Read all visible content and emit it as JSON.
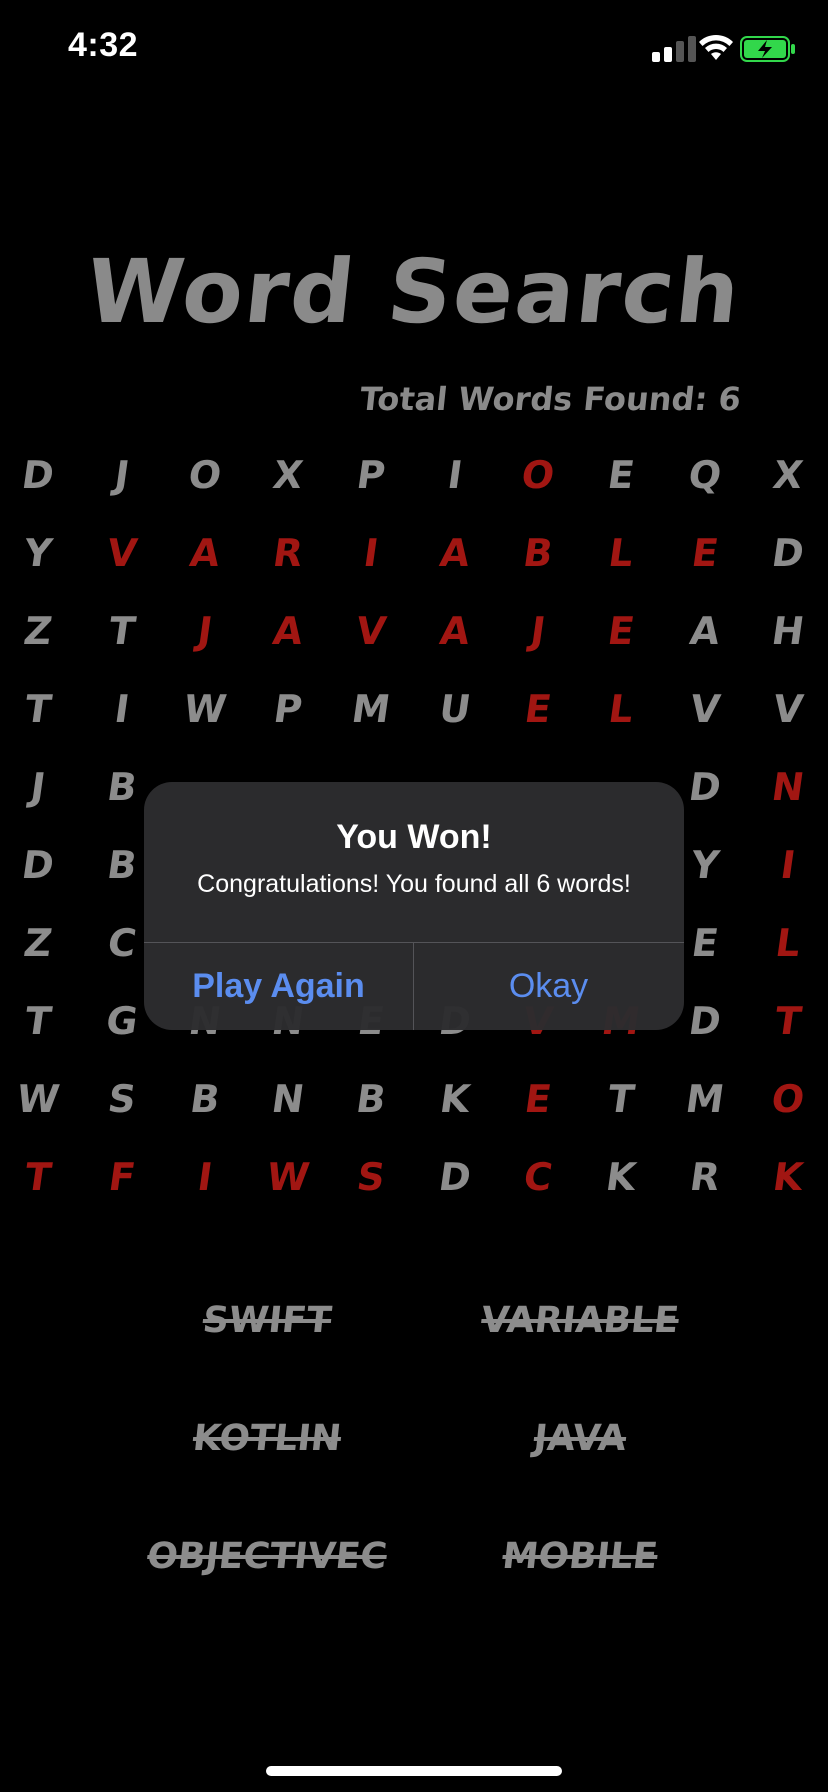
{
  "status_bar": {
    "time": "4:32",
    "icons": [
      "cellular-signal-icon",
      "wifi-icon",
      "battery-charging-icon"
    ],
    "battery_color": "#32d74b"
  },
  "title": "Word Search",
  "total_found": "Total Words Found: 6",
  "colors": {
    "letter": "#8c8c8c",
    "found_letter": "#a11612",
    "background": "#000000",
    "alert_button": "#5b8def"
  },
  "grid": [
    [
      {
        "l": "D",
        "f": false
      },
      {
        "l": "J",
        "f": false
      },
      {
        "l": "O",
        "f": false
      },
      {
        "l": "X",
        "f": false
      },
      {
        "l": "P",
        "f": false
      },
      {
        "l": "I",
        "f": false
      },
      {
        "l": "O",
        "f": true
      },
      {
        "l": "E",
        "f": false
      },
      {
        "l": "Q",
        "f": false
      },
      {
        "l": "X",
        "f": false
      }
    ],
    [
      {
        "l": "Y",
        "f": false
      },
      {
        "l": "V",
        "f": true
      },
      {
        "l": "A",
        "f": true
      },
      {
        "l": "R",
        "f": true
      },
      {
        "l": "I",
        "f": true
      },
      {
        "l": "A",
        "f": true
      },
      {
        "l": "B",
        "f": true
      },
      {
        "l": "L",
        "f": true
      },
      {
        "l": "E",
        "f": true
      },
      {
        "l": "D",
        "f": false
      }
    ],
    [
      {
        "l": "Z",
        "f": false
      },
      {
        "l": "T",
        "f": false
      },
      {
        "l": "J",
        "f": true
      },
      {
        "l": "A",
        "f": true
      },
      {
        "l": "V",
        "f": true
      },
      {
        "l": "A",
        "f": true
      },
      {
        "l": "J",
        "f": true
      },
      {
        "l": "E",
        "f": true
      },
      {
        "l": "A",
        "f": false
      },
      {
        "l": "H",
        "f": false
      }
    ],
    [
      {
        "l": "T",
        "f": false
      },
      {
        "l": "I",
        "f": false
      },
      {
        "l": "W",
        "f": false
      },
      {
        "l": "P",
        "f": false
      },
      {
        "l": "M",
        "f": false
      },
      {
        "l": "U",
        "f": false
      },
      {
        "l": "E",
        "f": true
      },
      {
        "l": "L",
        "f": true
      },
      {
        "l": "V",
        "f": false
      },
      {
        "l": "V",
        "f": false
      }
    ],
    [
      {
        "l": "J",
        "f": false
      },
      {
        "l": "B",
        "f": false
      },
      {
        "l": "",
        "f": false
      },
      {
        "l": "",
        "f": false
      },
      {
        "l": "",
        "f": false
      },
      {
        "l": "",
        "f": false
      },
      {
        "l": "",
        "f": false
      },
      {
        "l": "",
        "f": false
      },
      {
        "l": "D",
        "f": false
      },
      {
        "l": "N",
        "f": true
      }
    ],
    [
      {
        "l": "D",
        "f": false
      },
      {
        "l": "B",
        "f": false
      },
      {
        "l": "",
        "f": false
      },
      {
        "l": "",
        "f": false
      },
      {
        "l": "",
        "f": false
      },
      {
        "l": "",
        "f": false
      },
      {
        "l": "",
        "f": false
      },
      {
        "l": "",
        "f": false
      },
      {
        "l": "Y",
        "f": false
      },
      {
        "l": "I",
        "f": true
      }
    ],
    [
      {
        "l": "Z",
        "f": false
      },
      {
        "l": "C",
        "f": false
      },
      {
        "l": "",
        "f": false
      },
      {
        "l": "",
        "f": false
      },
      {
        "l": "",
        "f": false
      },
      {
        "l": "",
        "f": false
      },
      {
        "l": "",
        "f": false
      },
      {
        "l": "",
        "f": false
      },
      {
        "l": "E",
        "f": false
      },
      {
        "l": "L",
        "f": true
      }
    ],
    [
      {
        "l": "T",
        "f": false
      },
      {
        "l": "G",
        "f": false
      },
      {
        "l": "N",
        "f": false
      },
      {
        "l": "N",
        "f": false
      },
      {
        "l": "E",
        "f": false
      },
      {
        "l": "D",
        "f": false
      },
      {
        "l": "V",
        "f": true
      },
      {
        "l": "M",
        "f": true
      },
      {
        "l": "D",
        "f": false
      },
      {
        "l": "T",
        "f": true
      }
    ],
    [
      {
        "l": "W",
        "f": false
      },
      {
        "l": "S",
        "f": false
      },
      {
        "l": "B",
        "f": false
      },
      {
        "l": "N",
        "f": false
      },
      {
        "l": "B",
        "f": false
      },
      {
        "l": "K",
        "f": false
      },
      {
        "l": "E",
        "f": true
      },
      {
        "l": "T",
        "f": false
      },
      {
        "l": "M",
        "f": false
      },
      {
        "l": "O",
        "f": true
      }
    ],
    [
      {
        "l": "T",
        "f": true
      },
      {
        "l": "F",
        "f": true
      },
      {
        "l": "I",
        "f": true
      },
      {
        "l": "W",
        "f": true
      },
      {
        "l": "S",
        "f": true
      },
      {
        "l": "D",
        "f": false
      },
      {
        "l": "C",
        "f": true
      },
      {
        "l": "K",
        "f": false
      },
      {
        "l": "R",
        "f": false
      },
      {
        "l": "K",
        "f": true
      }
    ]
  ],
  "words": [
    "SWIFT",
    "VARIABLE",
    "KOTLIN",
    "JAVA",
    "OBJECTIVEC",
    "MOBILE"
  ],
  "alert": {
    "title": "You Won!",
    "message": "Congratulations! You found all 6 words!",
    "primary_button": "Play Again",
    "secondary_button": "Okay"
  }
}
